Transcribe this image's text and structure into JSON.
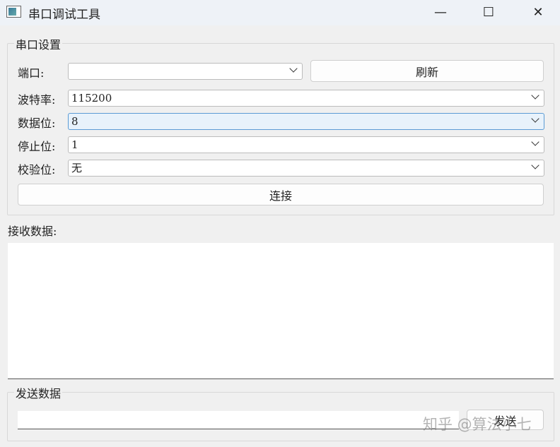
{
  "window": {
    "title": "串口调试工具",
    "minimize": "—",
    "maximize": "☐",
    "close": "✕"
  },
  "serial_settings": {
    "group_title": "串口设置",
    "port_label": "端口:",
    "port_value": "",
    "refresh_button": "刷新",
    "baud_label": "波特率:",
    "baud_value": "115200",
    "databits_label": "数据位:",
    "databits_value": "8",
    "stopbits_label": "停止位:",
    "stopbits_value": "1",
    "parity_label": "校验位:",
    "parity_value": "无",
    "connect_button": "连接"
  },
  "receive": {
    "label": "接收数据:",
    "content": ""
  },
  "send": {
    "group_title": "发送数据",
    "input_value": "",
    "send_button": "发送"
  },
  "watermark": "知乎 @算法小七"
}
